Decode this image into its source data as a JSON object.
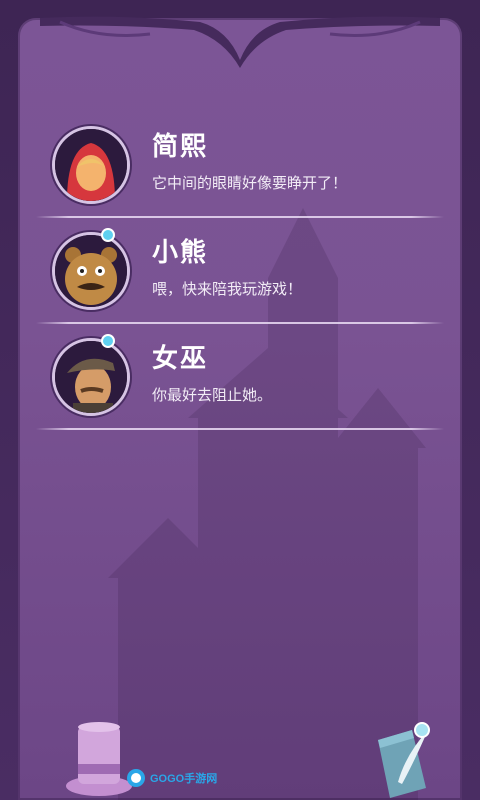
{
  "messages": [
    {
      "name": "简熙",
      "text": "它中间的眼睛好像要睁开了！",
      "has_notification": false,
      "avatar": "red-hood-girl"
    },
    {
      "name": "小熊",
      "text": "喂，快来陪我玩游戏！",
      "has_notification": true,
      "avatar": "bear"
    },
    {
      "name": "女巫",
      "text": "你最好去阻止她。",
      "has_notification": true,
      "avatar": "man-in-cap"
    }
  ],
  "footer": {
    "left_icon": "top-hat-icon",
    "right_icon": "scroll-quill-icon",
    "watermark": "GOGO手游网"
  },
  "colors": {
    "panel": "#7a5393",
    "frame": "#3e2554",
    "notification": "#5fd0f0"
  }
}
